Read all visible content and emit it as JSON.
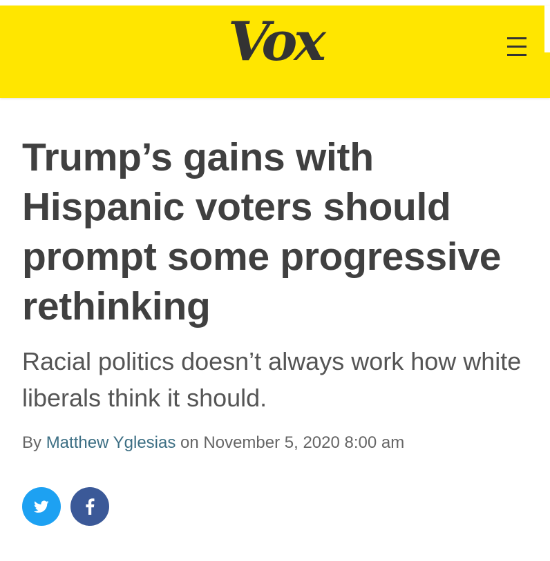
{
  "header": {
    "logo_text": "Vox",
    "background_color": "#ffe600",
    "menu_icon": "hamburger-menu-icon"
  },
  "article": {
    "headline": "Trump’s gains with Hispanic voters should prompt some progressive rethinking",
    "dek": "Racial politics doesn’t always work how white liberals think it should.",
    "byline": {
      "prefix": "By",
      "author": "Matthew Yglesias",
      "on": "on",
      "date": "November 5, 2020 8:00 am"
    }
  },
  "share": {
    "twitter": {
      "icon": "twitter-icon",
      "color": "#1da1f2"
    },
    "facebook": {
      "icon": "facebook-icon",
      "color": "#3b5998"
    }
  }
}
